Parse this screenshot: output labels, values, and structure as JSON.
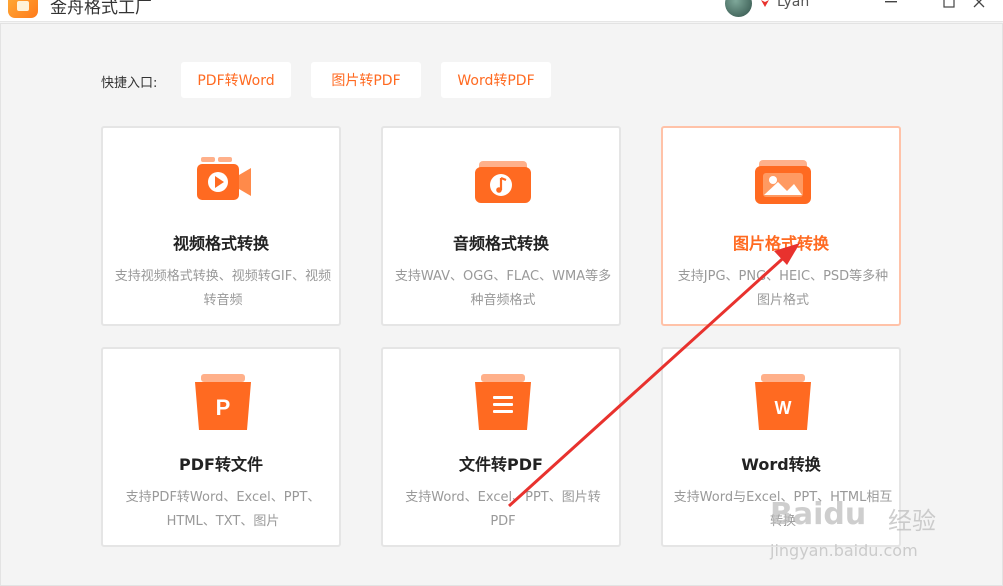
{
  "window": {
    "title": "金舟格式工厂",
    "user": {
      "name": "Lyan"
    }
  },
  "quick_entry": {
    "label": "快捷入口:",
    "buttons": [
      "PDF转Word",
      "图片转PDF",
      "Word转PDF"
    ]
  },
  "cards": [
    {
      "title": "视频格式转换",
      "desc": "支持视频格式转换、视频转GIF、视频转音频",
      "icon": "video-icon",
      "active": false
    },
    {
      "title": "音频格式转换",
      "desc": "支持WAV、OGG、FLAC、WMA等多种音频格式",
      "icon": "music-icon",
      "active": false
    },
    {
      "title": "图片格式转换",
      "desc": "支持JPG、PNG、HEIC、PSD等多种图片格式",
      "icon": "image-icon",
      "active": true
    },
    {
      "title": "PDF转文件",
      "desc": "支持PDF转Word、Excel、PPT、HTML、TXT、图片",
      "icon": "pdf-icon",
      "active": false
    },
    {
      "title": "文件转PDF",
      "desc": "支持Word、Excel、PPT、图片转PDF",
      "icon": "document-icon",
      "active": false
    },
    {
      "title": "Word转换",
      "desc": "支持Word与Excel、PPT、HTML相互转换",
      "icon": "word-icon",
      "active": false
    }
  ],
  "watermark": {
    "brand": "Baidu",
    "name": "经验",
    "url": "jingyan.baidu.com"
  },
  "colors": {
    "accent": "#ff6a21",
    "arrow": "#e8322e",
    "card_border": "#e5e5e5",
    "active_border": "#ffc2a8"
  }
}
